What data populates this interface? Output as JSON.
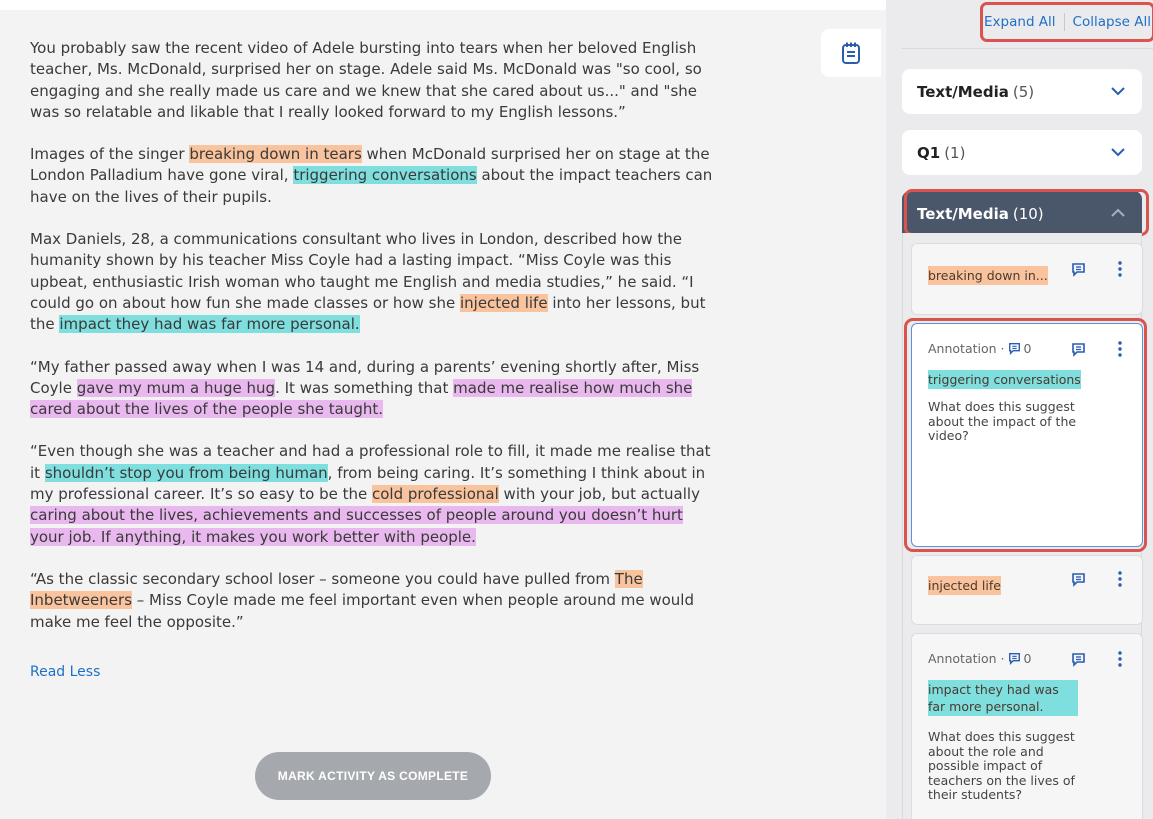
{
  "article": {
    "p1": "You probably saw the recent video of Adele bursting into tears when her beloved English teacher, Ms. McDonald, surprised her on stage. Adele said Ms. McDonald was \"so cool, so engaging and she really made us care and we knew that she cared about us...\" and \"she was so relatable and likable that I really looked forward to my English lessons.”",
    "p2": {
      "a": "Images of the singer ",
      "h1": "breaking down in tears",
      "b": " when McDonald surprised her on stage at the London Palladium have gone viral, ",
      "h2": "triggering conversations",
      "c": " about the impact teachers can have on the lives of their pupils."
    },
    "p3": {
      "a": "Max Daniels, 28, a communications consultant who lives in London, described how the humanity shown by his teacher Miss Coyle had a lasting impact. “Miss Coyle was this upbeat, enthusiastic Irish woman who taught me English and media studies,” he said. “I could go on about how fun she made classes or how she ",
      "h1": "injected life",
      "b": " into her lessons, but the ",
      "h2": "impact they had was far more personal."
    },
    "p4": {
      "a": "“My father passed away when I was 14 and, during a parents’ evening shortly after, Miss Coyle ",
      "h1": "gave my mum a huge hug",
      "b": ". It was something that ",
      "h2": "made me realise how much she cared about the lives of the people she taught."
    },
    "p5": {
      "a": "“Even though she was a teacher and had a professional role to fill, it made me realise that it ",
      "h1": "shouldn’t stop you from being human",
      "b": ", from being caring. It’s something I think about in my professional career. It’s so easy to be the ",
      "h2": "cold professional",
      "c": " with your job, but actually ",
      "h3": "caring about the lives, achievements and successes of people around you doesn’t hurt your job. If anything, it makes you work better with people."
    },
    "p6": {
      "a": "“As the classic secondary school loser – someone you could have pulled from ",
      "h1": "The Inbetweeners",
      "b": " – Miss Coyle made me feel important even when people around me would make me feel the opposite.”"
    },
    "read_less": "Read Less",
    "complete_button": "MARK ACTIVITY AS COMPLETE"
  },
  "sidebar": {
    "expand_all": "Expand All",
    "collapse_all": "Collapse All",
    "groups": [
      {
        "title": "Text/Media",
        "count": "(5)"
      },
      {
        "title": "Q1",
        "count": "(1)"
      },
      {
        "title": "Text/Media",
        "count": "(10)"
      }
    ],
    "cards": [
      {
        "snippet": "breaking down in..."
      },
      {
        "label": "Annotation ·",
        "comments": "0",
        "snippet": "triggering conversations",
        "note": "What does this suggest about the impact of the video?"
      },
      {
        "snippet": "injected life"
      },
      {
        "label": "Annotation ·",
        "comments": "0",
        "snippet": "impact they had was far more personal.",
        "note": "What does this suggest about the role and possible impact of teachers on the lives of their students?"
      }
    ]
  },
  "colors": {
    "highlight_orange": "#f9c49d",
    "highlight_teal": "#7fdede",
    "highlight_purple": "#e9b8ee",
    "link_blue": "#1f6fc7",
    "active_group": "#4a5669",
    "callout_red": "#d9534f"
  },
  "icons": [
    "notebook-icon",
    "chevron-down-icon",
    "chevron-up-icon",
    "comment-icon",
    "kebab-menu-icon"
  ]
}
